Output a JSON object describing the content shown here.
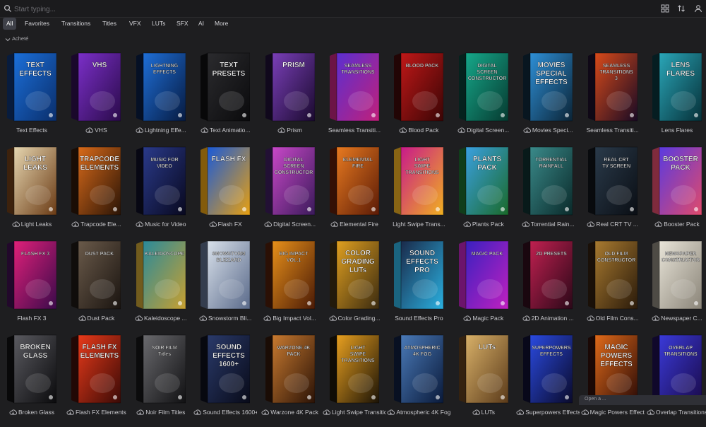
{
  "search": {
    "placeholder": "Start typing..."
  },
  "toolbar": {
    "icons": [
      "grid-view-icon",
      "sort-icon",
      "account-icon"
    ]
  },
  "tabs": [
    {
      "label": "All",
      "active": true
    },
    {
      "label": "Favorites"
    },
    {
      "label": "Transitions"
    },
    {
      "label": "Titles"
    },
    {
      "label": "VFX"
    },
    {
      "label": "LUTs"
    },
    {
      "label": "SFX"
    },
    {
      "label": "AI"
    },
    {
      "label": "More"
    }
  ],
  "section": {
    "title": "Acheté"
  },
  "products": [
    {
      "name": "Text Effects",
      "cover": "TEXT EFFECTS",
      "cloud": false,
      "colors": [
        "#1b6fd9",
        "#0a2e6b"
      ]
    },
    {
      "name": "VHS",
      "cover": "VHS",
      "cloud": true,
      "colors": [
        "#7b2fc8",
        "#2a0b4a"
      ]
    },
    {
      "name": "Lightning Effe...",
      "cover": "LIGHTNING EFFECTS",
      "cloud": true,
      "colors": [
        "#1f6fd8",
        "#061a40"
      ]
    },
    {
      "name": "Text Animatio...",
      "cover": "TEXT PRESETS",
      "cloud": true,
      "colors": [
        "#2b2b2e",
        "#0a0a0c"
      ]
    },
    {
      "name": "Prism",
      "cover": "PRISM",
      "cloud": true,
      "colors": [
        "#7a3fb8",
        "#1a0a2e"
      ]
    },
    {
      "name": "Seamless Transiti...",
      "cover": "SEAMLESS TRANSITIONS",
      "cloud": false,
      "colors": [
        "#5b2fd0",
        "#c0207a"
      ]
    },
    {
      "name": "Blood Pack",
      "cover": "BLOOD PACK",
      "cloud": true,
      "colors": [
        "#c01818",
        "#3a0505"
      ]
    },
    {
      "name": "Digital Screen...",
      "cover": "DIGITAL SCREEN CONSTRUCTOR 2",
      "cloud": true,
      "colors": [
        "#16a88a",
        "#063a30"
      ]
    },
    {
      "name": "Movies Speci...",
      "cover": "MOVIES SPECIAL EFFECTS",
      "cloud": true,
      "colors": [
        "#2e8fd6",
        "#0b2436"
      ]
    },
    {
      "name": "Seamless Transiti...",
      "cover": "SEAMLESS TRANSITIONS 3",
      "cloud": false,
      "colors": [
        "#d84a1a",
        "#180a24"
      ]
    },
    {
      "name": "Lens Flares",
      "cover": "LENS FLARES",
      "cloud": false,
      "colors": [
        "#2aa6b8",
        "#063038"
      ]
    },
    {
      "name": "Light Leaks",
      "cover": "LIGHT LEAKS",
      "cloud": true,
      "colors": [
        "#e6d6b0",
        "#6a3a14"
      ]
    },
    {
      "name": "Trapcode Ele...",
      "cover": "TRAPCODE ELEMENTS",
      "cloud": true,
      "colors": [
        "#d86a1a",
        "#2a1406"
      ]
    },
    {
      "name": "Music for Video",
      "cover": "MUSIC FOR VIDEO",
      "cloud": true,
      "colors": [
        "#2a3a8a",
        "#08081e"
      ]
    },
    {
      "name": "Flash FX",
      "cover": "FLASH FX",
      "cloud": true,
      "colors": [
        "#1a5ad8",
        "#e8a010"
      ]
    },
    {
      "name": "Digital Screen...",
      "cover": "DIGITAL SCREEN CONSTRUCTOR",
      "cloud": true,
      "colors": [
        "#c848c8",
        "#3a1a5a"
      ]
    },
    {
      "name": "Elemental Fire",
      "cover": "ELEMENTAL FIRE",
      "cloud": true,
      "colors": [
        "#e87a20",
        "#5a1a06"
      ]
    },
    {
      "name": "Light Swipe Trans...",
      "cover": "LIGHT SWIPE TRANSITIONS 2",
      "cloud": false,
      "colors": [
        "#c81a8a",
        "#f0b020"
      ]
    },
    {
      "name": "Plants Pack",
      "cover": "PLANTS PACK",
      "cloud": true,
      "colors": [
        "#3aa0e0",
        "#1a6a2a"
      ]
    },
    {
      "name": "Torrential Rain...",
      "cover": "TORRENTIAL RAINFALL",
      "cloud": true,
      "colors": [
        "#3a8a8a",
        "#0a2a2a"
      ]
    },
    {
      "name": "Real CRT TV ...",
      "cover": "REAL CRT TV SCREEN",
      "cloud": true,
      "colors": [
        "#2a3a4a",
        "#0a0e14"
      ]
    },
    {
      "name": "Booster Pack",
      "cover": "BOOSTER PACK",
      "cloud": true,
      "colors": [
        "#5a3ae0",
        "#e04a6a"
      ]
    },
    {
      "name": "Flash FX 3",
      "cover": "FLASH FX 3",
      "cloud": false,
      "colors": [
        "#e0207a",
        "#3a0a4a"
      ]
    },
    {
      "name": "Dust Pack",
      "cover": "DUST PACK",
      "cloud": true,
      "colors": [
        "#6a5a4a",
        "#1a1410"
      ]
    },
    {
      "name": "Kaleidoscope ...",
      "cover": "KALEIDOSCOPE",
      "cloud": true,
      "colors": [
        "#2a8a9a",
        "#c8a030"
      ]
    },
    {
      "name": "Snowstorm Bli...",
      "cover": "SNOWSTORM BLIZZARD",
      "cloud": true,
      "colors": [
        "#d8e0ea",
        "#5a6a8a"
      ]
    },
    {
      "name": "Big Impact Vol...",
      "cover": "BIG IMPACT VOL.1",
      "cloud": true,
      "colors": [
        "#e8901a",
        "#4a1a06"
      ]
    },
    {
      "name": "Color Grading...",
      "cover": "COLOR GRADING LUTs",
      "cloud": true,
      "colors": [
        "#e0a020",
        "#3a2a10"
      ]
    },
    {
      "name": "Sound Effects Pro",
      "cover": "SOUND EFFECTS PRO",
      "cloud": false,
      "colors": [
        "#1a2a4a",
        "#2ab0e0"
      ]
    },
    {
      "name": "Magic Pack",
      "cover": "MAGIC PACK",
      "cloud": true,
      "colors": [
        "#3a20c0",
        "#c020c0"
      ]
    },
    {
      "name": "2D Animation ...",
      "cover": "2D PRESETS",
      "cloud": true,
      "colors": [
        "#c02050",
        "#2a0818"
      ]
    },
    {
      "name": "Old Film Cons...",
      "cover": "OLD FILM CONSTRUCTOR",
      "cloud": true,
      "colors": [
        "#a87a30",
        "#2a1a0a"
      ]
    },
    {
      "name": "Newspaper C...",
      "cover": "NEWSPAPER CONSTRUCTOR",
      "cloud": true,
      "colors": [
        "#e8e4d8",
        "#8a8478"
      ]
    },
    {
      "name": "Broken Glass",
      "cover": "BROKEN GLASS",
      "cloud": true,
      "colors": [
        "#5a5a60",
        "#0a0a0c"
      ]
    },
    {
      "name": "Flash FX Elements",
      "cover": "FLASH FX ELEMENTS",
      "cloud": true,
      "colors": [
        "#e83a1a",
        "#3a0a06"
      ]
    },
    {
      "name": "Noir Film Titles",
      "cover": "NOIR FILM Titles",
      "cloud": true,
      "colors": [
        "#6a6a6e",
        "#101012"
      ]
    },
    {
      "name": "Sound Effects 1600+",
      "cover": "SOUND EFFECTS 1600+",
      "cloud": true,
      "colors": [
        "#2a3a6a",
        "#080a18"
      ]
    },
    {
      "name": "Warzone 4K Pack",
      "cover": "WARZONE 4K PACK",
      "cloud": true,
      "colors": [
        "#c87a30",
        "#2a1206"
      ]
    },
    {
      "name": "Light Swipe Transitions",
      "cover": "LIGHT SWIPE TRANSITIONS",
      "cloud": true,
      "colors": [
        "#e8a020",
        "#1a1206"
      ]
    },
    {
      "name": "Atmospheric 4K Fog",
      "cover": "ATMOSPHERIC 4K FOG",
      "cloud": true,
      "colors": [
        "#4a7ab8",
        "#0a1a3a"
      ]
    },
    {
      "name": "LUTs",
      "cover": "LUTs",
      "cloud": true,
      "colors": [
        "#d8b068",
        "#5a3a1a"
      ]
    },
    {
      "name": "Superpowers Effects",
      "cover": "SUPERPOWERS EFFECTS",
      "cloud": true,
      "colors": [
        "#2a4ae0",
        "#0a0a2a"
      ]
    },
    {
      "name": "Magic Powers Effects",
      "cover": "MAGIC POWERS EFFECTS",
      "cloud": true,
      "colors": [
        "#e06a1a",
        "#2a0a06"
      ]
    },
    {
      "name": "Overlap Transitions",
      "cover": "OVERLAP TRANSITIONS",
      "cloud": true,
      "colors": [
        "#3a3ad8",
        "#1a0a4a"
      ]
    }
  ],
  "toast": {
    "text": "Open a ..."
  }
}
